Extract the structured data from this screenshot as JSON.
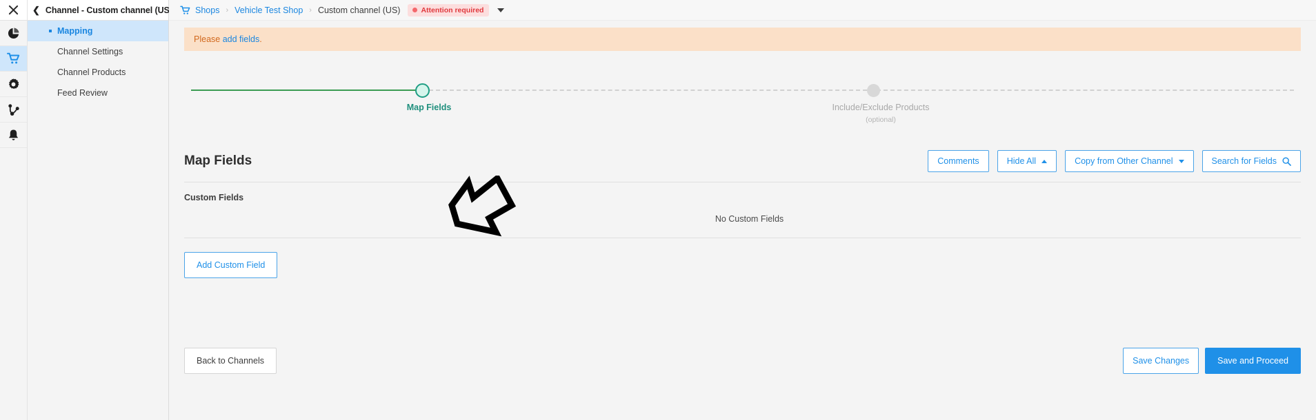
{
  "icon_rail": [
    {
      "name": "close-icon",
      "label": "Close"
    },
    {
      "name": "pie-chart-icon",
      "label": "Dashboard"
    },
    {
      "name": "shopping-cart-icon",
      "label": "Shops"
    },
    {
      "name": "gear-icon",
      "label": "Settings"
    },
    {
      "name": "share-nodes-icon",
      "label": "Integrations"
    },
    {
      "name": "bell-icon",
      "label": "Notifications"
    }
  ],
  "sidebar": {
    "title": "Channel - Custom channel (US)",
    "back_icon": "chevron-left-icon",
    "items": [
      {
        "label": "Mapping",
        "active": true
      },
      {
        "label": "Channel Settings",
        "active": false
      },
      {
        "label": "Channel Products",
        "active": false
      },
      {
        "label": "Feed Review",
        "active": false
      }
    ]
  },
  "breadcrumb": {
    "cart_icon": "shopping-cart-icon",
    "separator": "›",
    "items": [
      {
        "label": "Shops",
        "link": true
      },
      {
        "label": "Vehicle Test Shop",
        "link": true
      },
      {
        "label": "Custom channel (US)",
        "link": false
      }
    ],
    "status_badge": "Attention required",
    "status_color": "#e0393e",
    "status_bg": "#fcdede",
    "dropdown_icon": "chevron-down-icon"
  },
  "alert": {
    "prefix": "Please ",
    "link_text": "add fields",
    "suffix": ".",
    "bg_color": "#fbe0c8",
    "text_color": "#d2691e"
  },
  "stepper": {
    "steps": [
      {
        "label": "Map Fields",
        "sub": "",
        "state": "current",
        "color": "#1f8f7d"
      },
      {
        "label": "Include/Exclude Products",
        "sub": "(optional)",
        "state": "todo",
        "color": "#a8a8a8"
      }
    ],
    "done_line_color": "#3a9b52"
  },
  "panel": {
    "title": "Map Fields",
    "tools": [
      {
        "label": "Comments",
        "icon": ""
      },
      {
        "label": "Hide All",
        "icon": "caret-up-icon"
      },
      {
        "label": "Copy from Other Channel",
        "icon": "caret-down-icon"
      },
      {
        "label": "Search for Fields",
        "icon": "search-icon"
      }
    ],
    "section_label": "Custom Fields",
    "empty_text": "No Custom Fields",
    "add_button": "Add Custom Field"
  },
  "footer": {
    "back_label": "Back to Channels",
    "save_label": "Save Changes",
    "proceed_label": "Save and Proceed",
    "primary_color": "#1f90e8"
  },
  "annotation": {
    "name": "hand-drawn-arrow",
    "points_to": "Add Custom Field"
  }
}
